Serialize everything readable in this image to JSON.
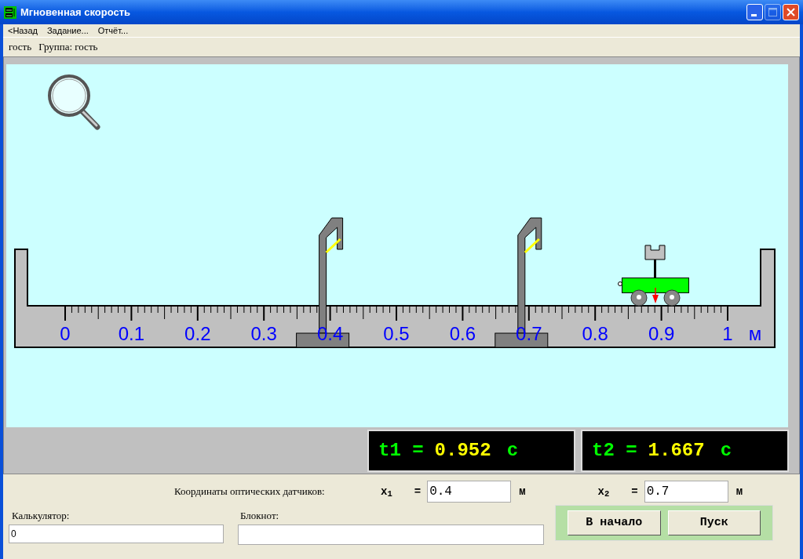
{
  "window": {
    "title": "Мгновенная скорость",
    "title_buttons": [
      {
        "kind": "minimize",
        "disabled": false
      },
      {
        "kind": "maximize",
        "disabled": true
      },
      {
        "kind": "close",
        "disabled": false
      }
    ]
  },
  "menu": [
    {
      "label": "<Назад"
    },
    {
      "label": "Задание..."
    },
    {
      "label": "Отчёт..."
    }
  ],
  "user": {
    "name": "гость",
    "group": "Группа: гость"
  },
  "scene": {
    "scale_labels": [
      "0",
      "0.1",
      "0.2",
      "0.3",
      "0.4",
      "0.5",
      "0.6",
      "0.7",
      "0.8",
      "0.9",
      "1"
    ],
    "unit": "м"
  },
  "timers": [
    {
      "label": "t1 =",
      "value": "0.952",
      "unit": "с"
    },
    {
      "label": "t2 =",
      "value": "1.667",
      "unit": "с"
    }
  ],
  "sensors": {
    "label": "Координаты оптических датчиков:",
    "fields": [
      {
        "label": "x$_{1}$",
        "equals": "=",
        "value": "0.4",
        "unit": "м"
      },
      {
        "label": "x$_{2}$",
        "equals": "=",
        "value": "0.7",
        "unit": "м"
      }
    ]
  },
  "calculator": {
    "label": "Калькулятор:",
    "value": "0"
  },
  "notepad": {
    "label": "Блокнот:"
  },
  "buttons": [
    {
      "label": "В начало"
    },
    {
      "label": "Пуск"
    }
  ]
}
